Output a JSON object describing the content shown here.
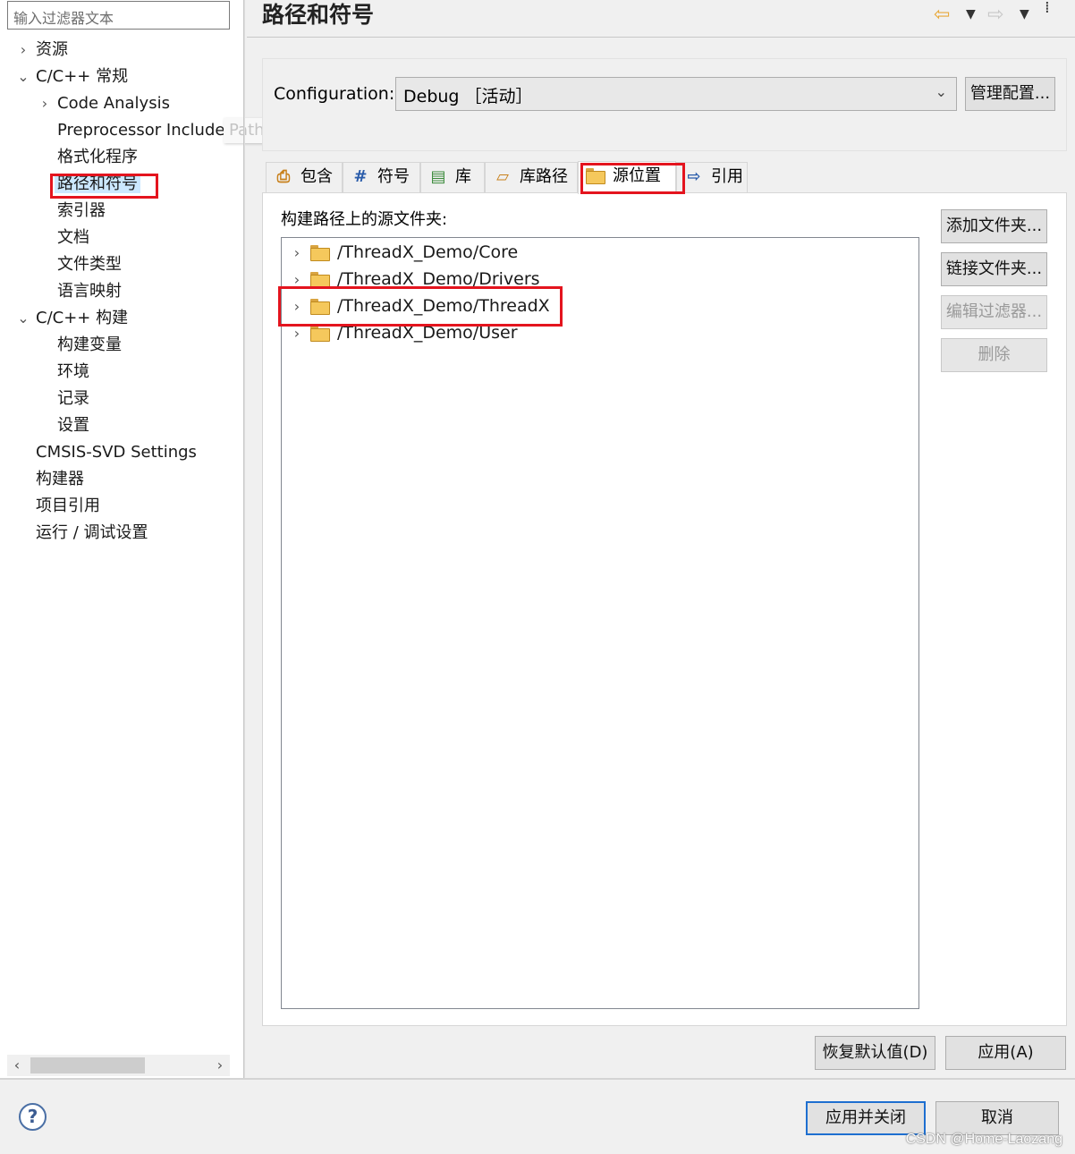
{
  "filter": {
    "placeholder": "输入过滤器文本"
  },
  "tree": [
    {
      "label": "资源",
      "expander": "›"
    },
    {
      "label": "C/C++ 常规",
      "expander": "⌄"
    },
    {
      "label": "Code Analysis",
      "expander": "›"
    },
    {
      "label": "Preprocessor Include",
      "expander": ""
    },
    {
      "label": "格式化程序",
      "expander": ""
    },
    {
      "label": "路径和符号",
      "expander": "",
      "selected": true
    },
    {
      "label": "索引器",
      "expander": ""
    },
    {
      "label": "文档",
      "expander": ""
    },
    {
      "label": "文件类型",
      "expander": ""
    },
    {
      "label": "语言映射",
      "expander": ""
    },
    {
      "label": "C/C++ 构建",
      "expander": "⌄"
    },
    {
      "label": "构建变量",
      "expander": ""
    },
    {
      "label": "环境",
      "expander": ""
    },
    {
      "label": "记录",
      "expander": ""
    },
    {
      "label": "设置",
      "expander": ""
    },
    {
      "label": "CMSIS-SVD Settings",
      "expander": ""
    },
    {
      "label": "构建器",
      "expander": ""
    },
    {
      "label": "项目引用",
      "expander": ""
    },
    {
      "label": "运行 / 调试设置",
      "expander": ""
    }
  ],
  "tooltip_tail": "Paths, Macros etc.",
  "page_title": "路径和符号",
  "configuration": {
    "label": "Configuration:",
    "value": "Debug ［活动］",
    "manage_button": "管理配置..."
  },
  "tabs": [
    {
      "label": "包含",
      "icon": "include-icon",
      "glyph": "⎙"
    },
    {
      "label": "符号",
      "icon": "symbol-icon",
      "glyph": "#"
    },
    {
      "label": "库",
      "icon": "library-icon",
      "glyph": "▤"
    },
    {
      "label": "库路径",
      "icon": "library-path-icon",
      "glyph": "▱"
    },
    {
      "label": "源位置",
      "icon": "source-folder-icon",
      "glyph": "",
      "active": true
    },
    {
      "label": "引用",
      "icon": "reference-icon",
      "glyph": "⇨"
    }
  ],
  "source_list": {
    "label": "构建路径上的源文件夹:",
    "items": [
      "/ThreadX_Demo/Core",
      "/ThreadX_Demo/Drivers",
      "/ThreadX_Demo/ThreadX",
      "/ThreadX_Demo/User"
    ]
  },
  "side_buttons": {
    "add_folder": "添加文件夹...",
    "link_folder": "链接文件夹...",
    "edit_filter": "编辑过滤器...",
    "delete": "删除"
  },
  "restore_defaults": "恢复默认值(D)",
  "apply": "应用(A)",
  "apply_close": "应用并关闭",
  "cancel": "取消",
  "help_glyph": "?",
  "watermark": "CSDN @Home-Laozang",
  "colors": {
    "highlight": "#e4141e",
    "selection": "#cce8ff",
    "accent": "#1e6fd0"
  }
}
